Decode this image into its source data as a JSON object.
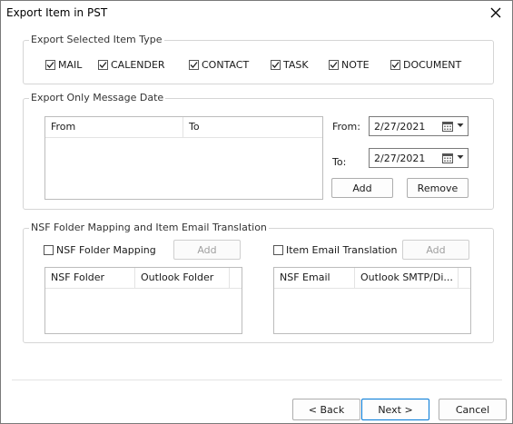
{
  "window": {
    "title": "Export Item in PST"
  },
  "item_type": {
    "legend": "Export Selected Item Type",
    "items": [
      {
        "label": "MAIL",
        "checked": true
      },
      {
        "label": "CALENDER",
        "checked": true
      },
      {
        "label": "CONTACT",
        "checked": true
      },
      {
        "label": "TASK",
        "checked": true
      },
      {
        "label": "NOTE",
        "checked": true
      },
      {
        "label": "DOCUMENT",
        "checked": true
      }
    ]
  },
  "message_date": {
    "legend": "Export Only Message Date",
    "columns": [
      "From",
      "To"
    ],
    "from_label": "From:",
    "from_value": "2/27/2021",
    "to_label": "To:",
    "to_value": "2/27/2021",
    "add_label": "Add",
    "remove_label": "Remove"
  },
  "nsf": {
    "legend": "NSF Folder Mapping and Item Email Translation",
    "folder_mapping_label": "NSF Folder Mapping",
    "folder_mapping_checked": false,
    "folder_add_label": "Add",
    "folder_columns": [
      "NSF Folder",
      "Outlook Folder"
    ],
    "email_translation_label": "Item Email Translation",
    "email_translation_checked": false,
    "email_add_label": "Add",
    "email_columns": [
      "NSF Email",
      "Outlook SMTP/Di..."
    ]
  },
  "footer": {
    "back_label": "< Back",
    "next_label": "Next >",
    "cancel_label": "Cancel"
  }
}
